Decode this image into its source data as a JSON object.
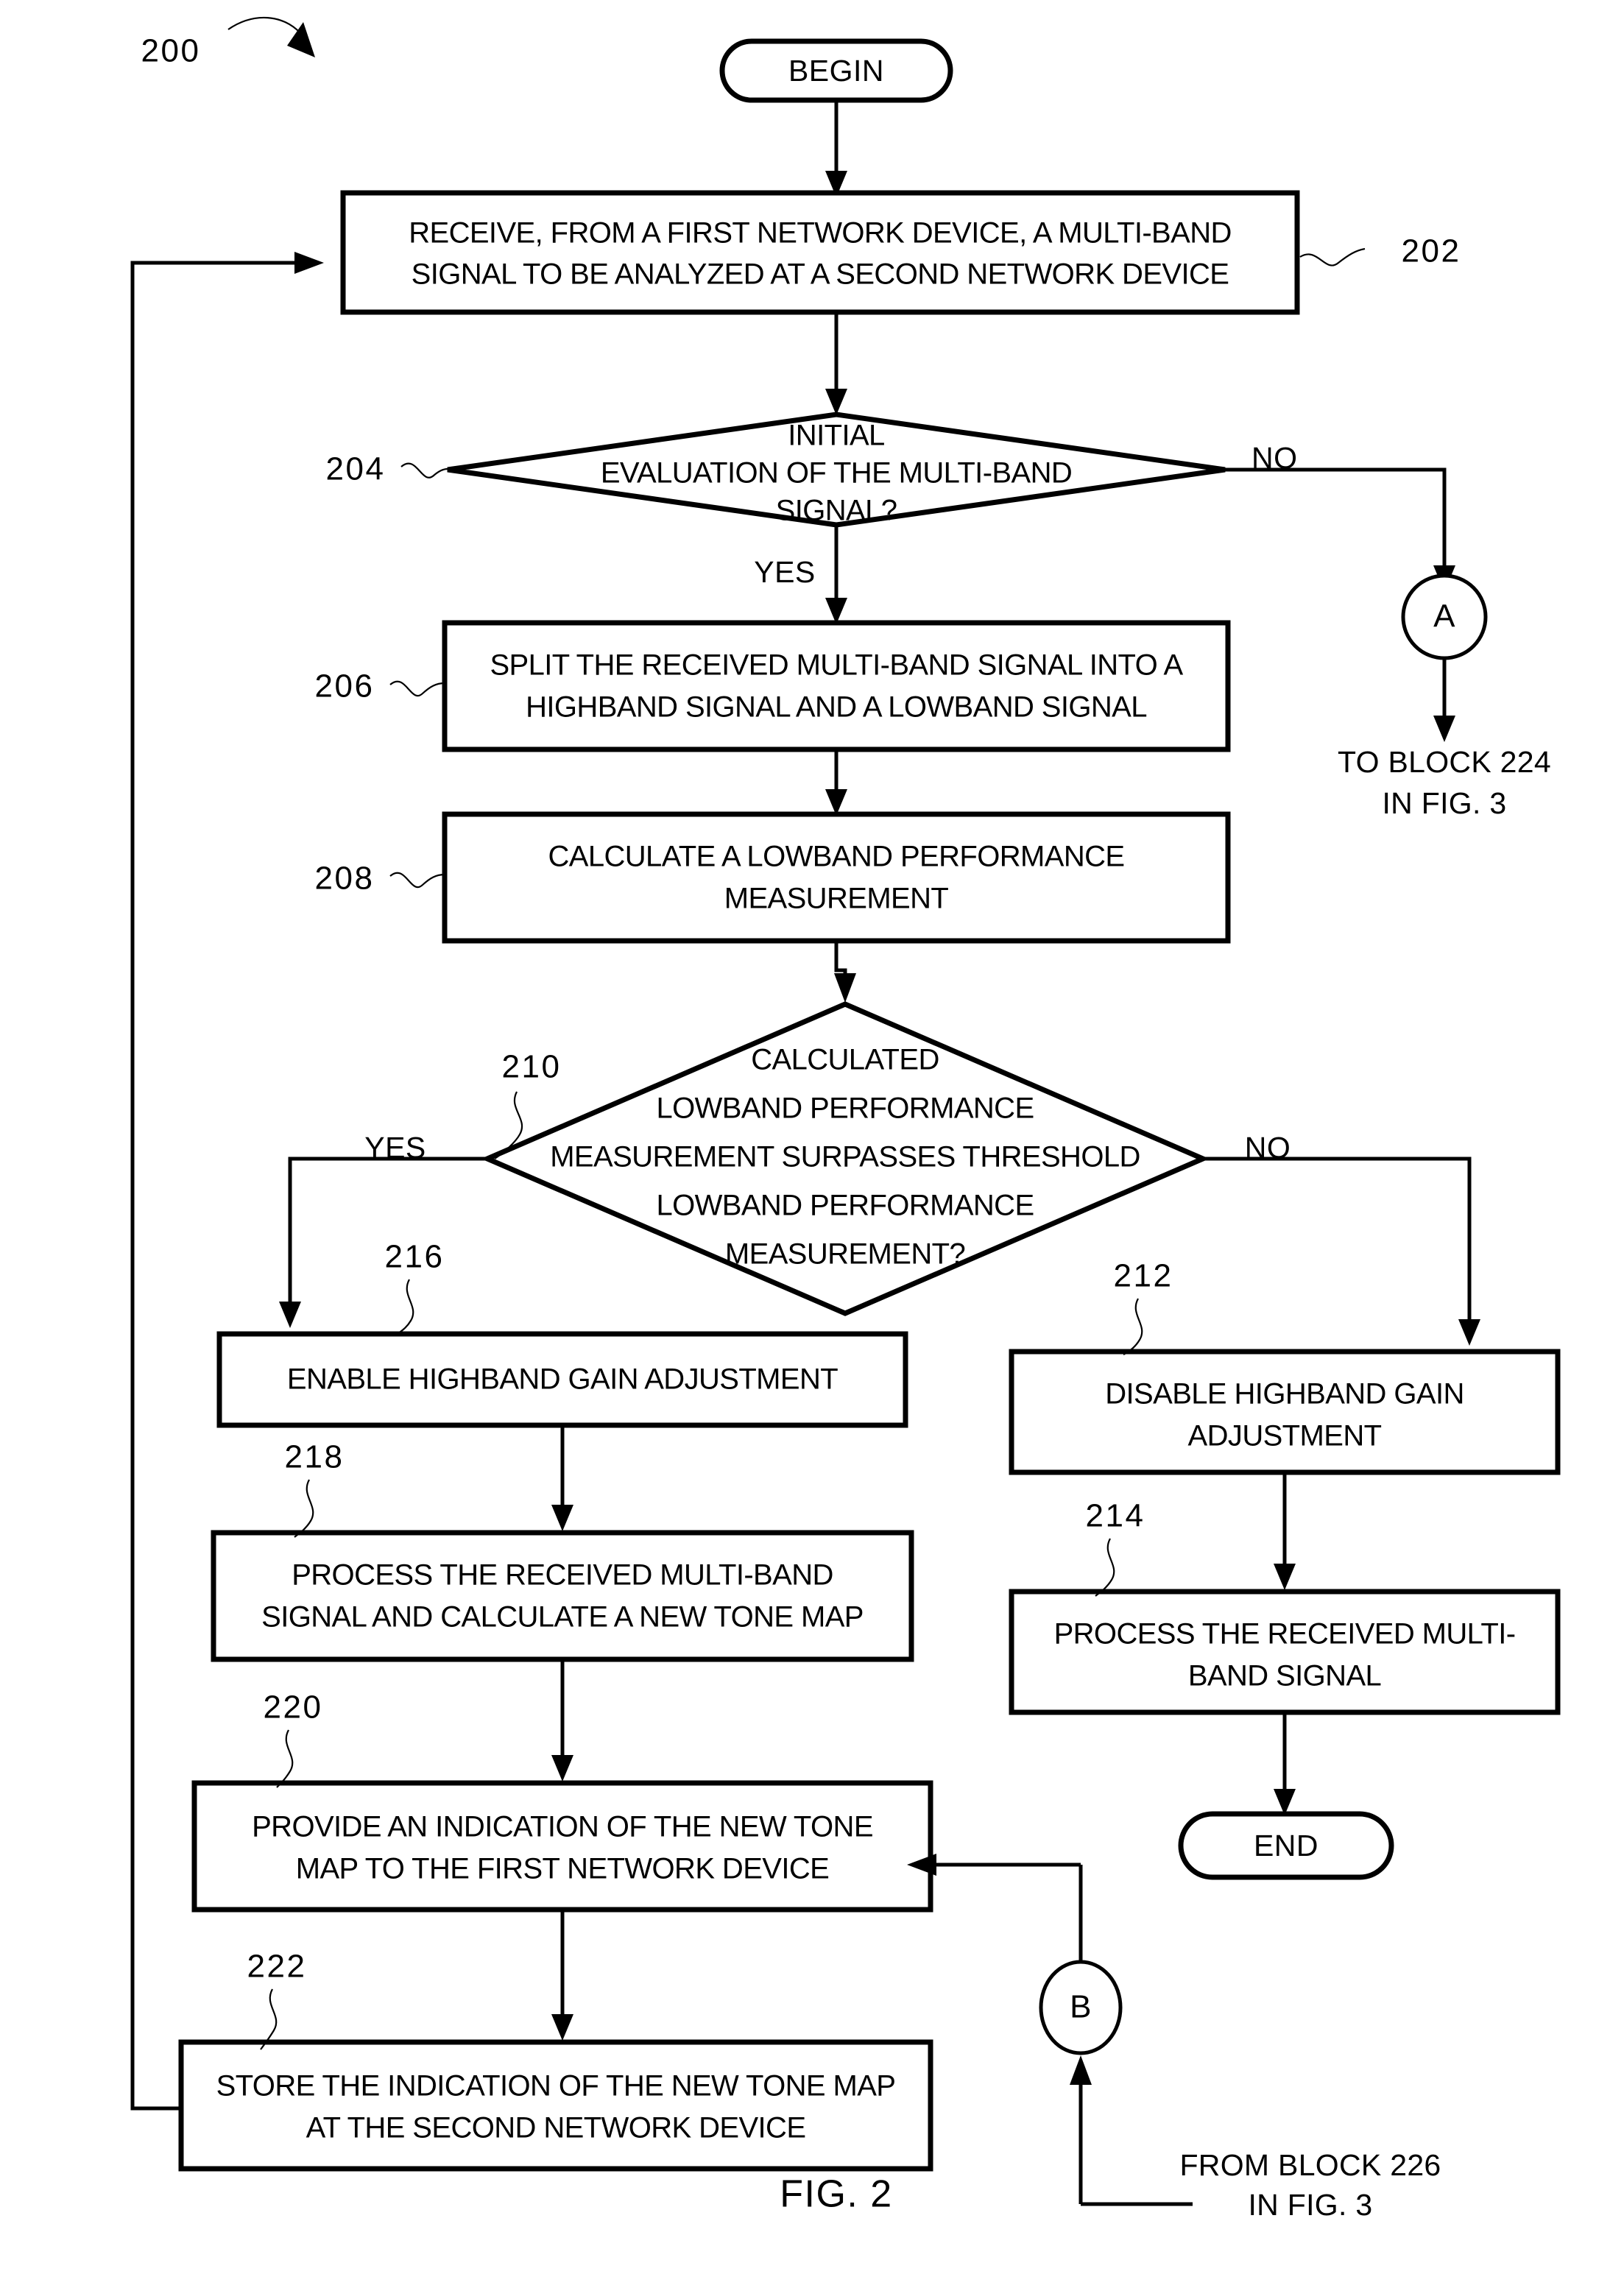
{
  "figure": {
    "caption": "FIG. 2",
    "diagram_ref": "200"
  },
  "terminators": {
    "begin": "BEGIN",
    "end": "END"
  },
  "connectors": {
    "a": {
      "letter": "A",
      "note_line1": "TO BLOCK 224",
      "note_line2": "IN FIG. 3"
    },
    "b": {
      "letter": "B",
      "note_line1": "FROM BLOCK 226",
      "note_line2": "IN FIG. 3"
    }
  },
  "branch_labels": {
    "d204_no": "NO",
    "d204_yes": "YES",
    "d210_yes": "YES",
    "d210_no": "NO"
  },
  "blocks": [
    {
      "ref": "202",
      "type": "process",
      "lines": [
        "RECEIVE, FROM A FIRST NETWORK DEVICE, A MULTI-BAND",
        "SIGNAL TO BE ANALYZED AT A SECOND NETWORK DEVICE"
      ]
    },
    {
      "ref": "204",
      "type": "decision",
      "lines": [
        "INITIAL",
        "EVALUATION OF THE MULTI-BAND",
        "SIGNAL?"
      ]
    },
    {
      "ref": "206",
      "type": "process",
      "lines": [
        "SPLIT THE RECEIVED MULTI-BAND SIGNAL INTO A",
        "HIGHBAND SIGNAL AND A LOWBAND SIGNAL"
      ]
    },
    {
      "ref": "208",
      "type": "process",
      "lines": [
        "CALCULATE A LOWBAND PERFORMANCE",
        "MEASUREMENT"
      ]
    },
    {
      "ref": "210",
      "type": "decision",
      "lines": [
        "CALCULATED",
        "LOWBAND PERFORMANCE",
        "MEASUREMENT SURPASSES THRESHOLD",
        "LOWBAND PERFORMANCE",
        "MEASUREMENT?"
      ]
    },
    {
      "ref": "212",
      "type": "process",
      "lines": [
        "DISABLE HIGHBAND GAIN",
        "ADJUSTMENT"
      ]
    },
    {
      "ref": "214",
      "type": "process",
      "lines": [
        "PROCESS THE RECEIVED MULTI-",
        "BAND SIGNAL"
      ]
    },
    {
      "ref": "216",
      "type": "process",
      "lines": [
        "ENABLE HIGHBAND GAIN ADJUSTMENT"
      ]
    },
    {
      "ref": "218",
      "type": "process",
      "lines": [
        "PROCESS THE RECEIVED MULTI-BAND",
        "SIGNAL AND CALCULATE A NEW TONE MAP"
      ]
    },
    {
      "ref": "220",
      "type": "process",
      "lines": [
        "PROVIDE AN INDICATION OF THE NEW TONE",
        "MAP TO THE FIRST NETWORK DEVICE"
      ]
    },
    {
      "ref": "222",
      "type": "process",
      "lines": [
        "STORE THE INDICATION OF THE NEW TONE MAP",
        "AT THE SECOND NETWORK DEVICE"
      ]
    }
  ],
  "colors": {
    "ink": "#000000",
    "paper": "#ffffff"
  }
}
